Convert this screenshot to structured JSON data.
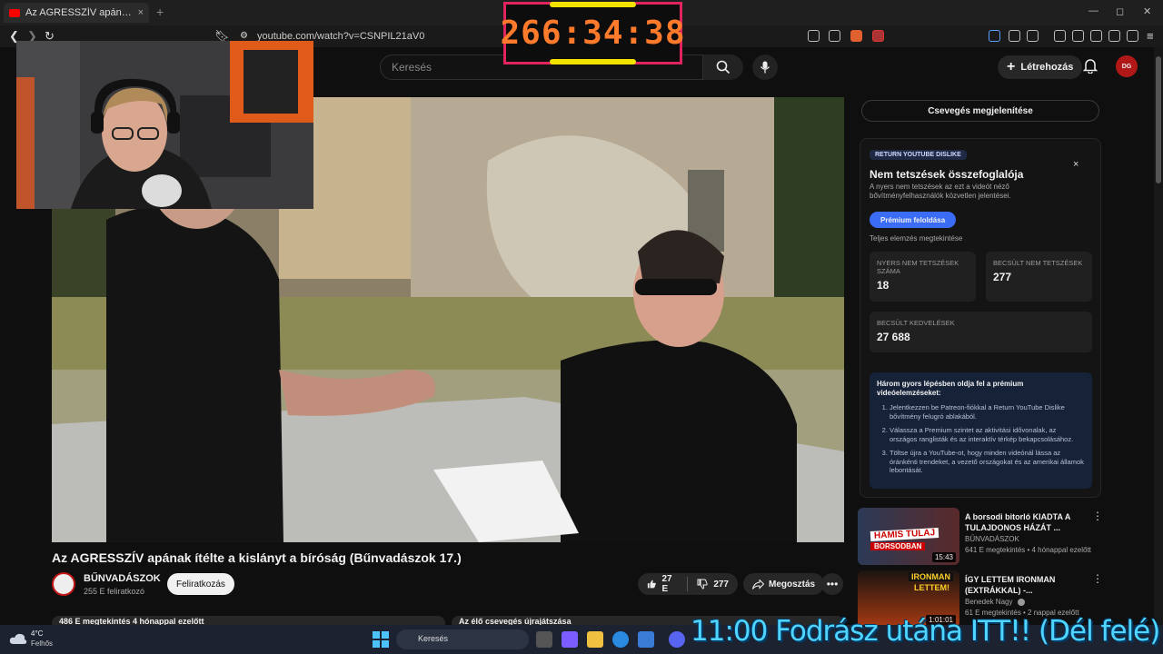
{
  "browser": {
    "tab_title": "Az AGRESSZÍV apának ítélte a kislányt a bíróság",
    "tab_close": "×",
    "new_tab": "+",
    "url": "youtube.com/watch?v=CSNPIL21aV0",
    "window_controls": [
      "—",
      "◻",
      "✕"
    ]
  },
  "youtube": {
    "search_placeholder": "Keresés",
    "create_label": "Létrehozás",
    "avatar_text": "DG"
  },
  "timer": {
    "value": "266:34:38"
  },
  "video": {
    "title": "Az AGRESSZÍV apának ítélte a kislányt a bíróság (Bűnvadászok 17.)",
    "channel_name": "BŰNVADÁSZOK",
    "channel_subs": "255 E feliratkozó",
    "subscribe_label": "Feliratkozás",
    "likes": "27 E",
    "dislikes": "277",
    "share_label": "Megosztás",
    "more": "•••",
    "views_info": "486 E megtekintés  4 hónappal ezelőtt",
    "chat_replay": "Az élő csevegés újrajátszása"
  },
  "sidebar": {
    "chat_button": "Csevegés megjelenítése",
    "ryd": {
      "tag": "RETURN YOUTUBE DISLIKE",
      "close": "×",
      "title": "Nem tetszések összefoglalója",
      "description": "A nyers nem tetszések az ezt a videót néző bővítményfelhasználók közvetlen jelentései.",
      "premium_button": "Prémium feloldása",
      "full_analysis": "Teljes elemzés megtekintése",
      "stats": [
        {
          "label": "NYERS NEM TETSZÉSEK SZÁMA",
          "value": "18"
        },
        {
          "label": "BECSÜLT NEM TETSZÉSEK",
          "value": "277"
        },
        {
          "label": "BECSÜLT KEDVELÉSEK",
          "value": "27 688"
        }
      ],
      "steps_title": "Három gyors lépésben oldja fel a prémium videóelemzéseket:",
      "steps": [
        "Jelentkezzen be Patreon-fiókkal a Return YouTube Dislike bővítmény felugró ablakából.",
        "Válassza a Premium szintet az aktivitási idővonalak, az országos ranglisták és az interaktív térkép bekapcsolásához.",
        "Töltse újra a YouTube-ot, hogy minden videónál lássa az óránkénti trendeket, a vezető országokat és az amerikai államok lebontását."
      ]
    },
    "recommendations": [
      {
        "title": "A borsodi bitorló KIADTA A TULAJDONOS HÁZÁT ...",
        "channel": "BŰNVADÁSZOK",
        "meta": "641 E megtekintés • 4 hónappal ezelőtt",
        "duration": "15:43",
        "thumb_text_1": "HAMIS TULAJ",
        "thumb_text_2": "BORSODBAN",
        "more": "⋮"
      },
      {
        "title": "ÍGY LETTEM IRONMAN (EXTRÁKKAL) -...",
        "channel": "Benedek Nagy",
        "meta": "61 E megtekintés • 2 nappal ezelőtt",
        "duration": "1:01:01",
        "thumb_text_1": "IRONMAN",
        "thumb_text_2": "LETTEM!",
        "more": "⋮"
      }
    ]
  },
  "taskbar": {
    "temperature": "4°C",
    "weather": "Felhős",
    "search": "Keresés"
  },
  "stream_overlay": {
    "text": "11:00 Fodrász utána ITT!! (Dél felé)"
  },
  "colors": {
    "yt_red": "#ff0000",
    "timer_border": "#e0245e",
    "timer_digits": "#ff7a2a",
    "timer_bars": "#f2e200",
    "premium_blue": "#3b6cf5",
    "overlay_cyan": "#4fd5ff"
  }
}
